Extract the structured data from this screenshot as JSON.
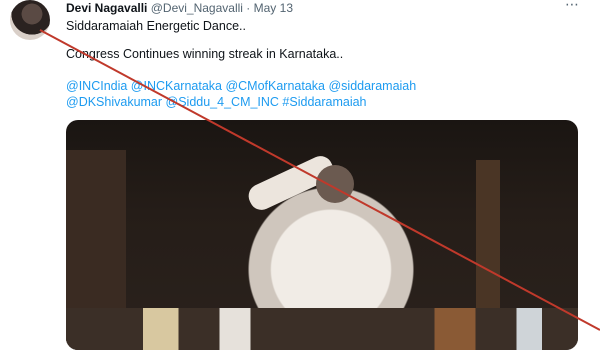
{
  "tweet": {
    "author_name": "Devi Nagavalli",
    "author_handle": "@Devi_Nagavalli",
    "separator": "·",
    "date": "May 13",
    "more_icon": "more-horizontal-icon",
    "line1": "Siddaramaiah Energetic Dance..",
    "line2": "Congress Continues winning streak in Karnataka..",
    "hashtags_line1": "@INCIndia @INCKarnataka @CMofKarnataka @siddaramaiah",
    "hashtags_line2": "@DKShivakumar @Siddu_4_CM_INC #Siddaramaiah"
  },
  "colors": {
    "link": "#1d9bf0",
    "muted": "#536471",
    "strike_line": "#c0392b"
  }
}
